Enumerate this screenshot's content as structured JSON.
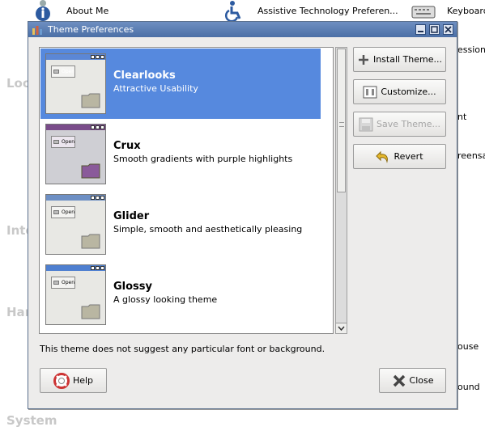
{
  "background": {
    "items": [
      {
        "label": "About Me",
        "icon": "about-me-icon"
      },
      {
        "label": "Assistive Technology Preferen...",
        "icon": "accessibility-icon"
      },
      {
        "label": "Keyboard",
        "icon": "keyboard-icon"
      }
    ],
    "categories": [
      "Loo",
      "Inte",
      "Har",
      "System"
    ],
    "fragments": [
      "essions",
      "nt",
      "reensa",
      "ouse",
      "ound"
    ]
  },
  "dialog": {
    "title": "Theme Preferences",
    "themes": [
      {
        "name": "Clearlooks",
        "description": "Attractive Usability",
        "selected": true
      },
      {
        "name": "Crux",
        "description": "Smooth gradients with purple highlights",
        "selected": false
      },
      {
        "name": "Glider",
        "description": "Simple, smooth and aesthetically pleasing",
        "selected": false
      },
      {
        "name": "Glossy",
        "description": "A glossy looking theme",
        "selected": false
      }
    ],
    "preview_button_label": "Open",
    "buttons": {
      "install": "Install Theme...",
      "customize": "Customize...",
      "save": "Save Theme...",
      "revert": "Revert",
      "help": "Help",
      "close": "Close"
    },
    "note": "This theme does not suggest any particular font or background."
  },
  "colors": {
    "selection": "#5689de",
    "titlebar": "#4b6fa6",
    "crux_accent": "#7a4c8a"
  }
}
